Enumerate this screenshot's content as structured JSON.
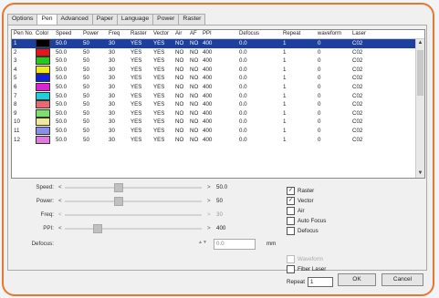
{
  "tabs": [
    {
      "label": "Options",
      "active": false
    },
    {
      "label": "Pen",
      "active": true
    },
    {
      "label": "Advanced",
      "active": false
    },
    {
      "label": "Paper",
      "active": false
    },
    {
      "label": "Language",
      "active": false
    },
    {
      "label": "Power",
      "active": false
    },
    {
      "label": "Raster",
      "active": false
    }
  ],
  "table": {
    "headers": [
      "Pen No.",
      "Color",
      "Speed",
      "Power",
      "Freq",
      "Raster",
      "Vector",
      "Air",
      "AF",
      "PPI",
      "Defocus",
      "Repeat",
      "waveform",
      "Laser"
    ],
    "rows": [
      {
        "pen": "1",
        "color": "#000000",
        "speed": "50.0",
        "power": "50",
        "freq": "30",
        "raster": "YES",
        "vector": "YES",
        "air": "NO",
        "af": "NO",
        "ppi": "400",
        "defocus": "0.0",
        "repeat": "1",
        "waveform": "0",
        "laser": "C02",
        "selected": true
      },
      {
        "pen": "2",
        "color": "#e8141c",
        "speed": "50.0",
        "power": "50",
        "freq": "30",
        "raster": "YES",
        "vector": "YES",
        "air": "NO",
        "af": "NO",
        "ppi": "400",
        "defocus": "0.0",
        "repeat": "1",
        "waveform": "0",
        "laser": "C02",
        "selected": false
      },
      {
        "pen": "3",
        "color": "#26c81e",
        "speed": "50.0",
        "power": "50",
        "freq": "30",
        "raster": "YES",
        "vector": "YES",
        "air": "NO",
        "af": "NO",
        "ppi": "400",
        "defocus": "0.0",
        "repeat": "1",
        "waveform": "0",
        "laser": "C02",
        "selected": false
      },
      {
        "pen": "4",
        "color": "#f0e81a",
        "speed": "50.0",
        "power": "50",
        "freq": "30",
        "raster": "YES",
        "vector": "YES",
        "air": "NO",
        "af": "NO",
        "ppi": "400",
        "defocus": "0.0",
        "repeat": "1",
        "waveform": "0",
        "laser": "C02",
        "selected": false
      },
      {
        "pen": "5",
        "color": "#1222d8",
        "speed": "50.0",
        "power": "50",
        "freq": "30",
        "raster": "YES",
        "vector": "YES",
        "air": "NO",
        "af": "NO",
        "ppi": "400",
        "defocus": "0.0",
        "repeat": "1",
        "waveform": "0",
        "laser": "C02",
        "selected": false
      },
      {
        "pen": "6",
        "color": "#e020d8",
        "speed": "50.0",
        "power": "50",
        "freq": "30",
        "raster": "YES",
        "vector": "YES",
        "air": "NO",
        "af": "NO",
        "ppi": "400",
        "defocus": "0.0",
        "repeat": "1",
        "waveform": "0",
        "laser": "C02",
        "selected": false
      },
      {
        "pen": "7",
        "color": "#20d0d8",
        "speed": "50.0",
        "power": "50",
        "freq": "30",
        "raster": "YES",
        "vector": "YES",
        "air": "NO",
        "af": "NO",
        "ppi": "400",
        "defocus": "0.0",
        "repeat": "1",
        "waveform": "0",
        "laser": "C02",
        "selected": false
      },
      {
        "pen": "8",
        "color": "#e86a70",
        "speed": "50.0",
        "power": "50",
        "freq": "30",
        "raster": "YES",
        "vector": "YES",
        "air": "NO",
        "af": "NO",
        "ppi": "400",
        "defocus": "0.0",
        "repeat": "1",
        "waveform": "0",
        "laser": "C02",
        "selected": false
      },
      {
        "pen": "9",
        "color": "#7ae070",
        "speed": "50.0",
        "power": "50",
        "freq": "30",
        "raster": "YES",
        "vector": "YES",
        "air": "NO",
        "af": "NO",
        "ppi": "400",
        "defocus": "0.0",
        "repeat": "1",
        "waveform": "0",
        "laser": "C02",
        "selected": false
      },
      {
        "pen": "10",
        "color": "#f0e898",
        "speed": "50.0",
        "power": "50",
        "freq": "30",
        "raster": "YES",
        "vector": "YES",
        "air": "NO",
        "af": "NO",
        "ppi": "400",
        "defocus": "0.0",
        "repeat": "1",
        "waveform": "0",
        "laser": "C02",
        "selected": false
      },
      {
        "pen": "11",
        "color": "#8a8ee8",
        "speed": "50.0",
        "power": "50",
        "freq": "30",
        "raster": "YES",
        "vector": "YES",
        "air": "NO",
        "af": "NO",
        "ppi": "400",
        "defocus": "0.0",
        "repeat": "1",
        "waveform": "0",
        "laser": "C02",
        "selected": false
      },
      {
        "pen": "12",
        "color": "#e07ae0",
        "speed": "50.0",
        "power": "50",
        "freq": "30",
        "raster": "YES",
        "vector": "YES",
        "air": "NO",
        "af": "NO",
        "ppi": "400",
        "defocus": "0.0",
        "repeat": "1",
        "waveform": "0",
        "laser": "C02",
        "selected": false
      }
    ]
  },
  "params": [
    {
      "label": "Speed:",
      "value": "50.0",
      "level": 0.38,
      "disabled": false
    },
    {
      "label": "Power:",
      "value": "50",
      "level": 0.38,
      "disabled": false
    },
    {
      "label": "Freq:",
      "value": "30",
      "level": 0.0,
      "disabled": true
    },
    {
      "label": "PPI:",
      "value": "400",
      "level": 0.22,
      "disabled": false
    }
  ],
  "defocus": {
    "label": "Defocus:",
    "value": "0.0",
    "unit": "mm"
  },
  "checks": [
    {
      "label": "Raster",
      "checked": true,
      "disabled": false
    },
    {
      "label": "Vector",
      "checked": true,
      "disabled": false
    },
    {
      "label": "Air",
      "checked": false,
      "disabled": false
    },
    {
      "label": "Auto Focus",
      "checked": false,
      "disabled": false
    },
    {
      "label": "Defocus",
      "checked": false,
      "disabled": false
    }
  ],
  "checks2": [
    {
      "label": "Waveform",
      "checked": false,
      "disabled": true
    },
    {
      "label": "Fiber Laser",
      "checked": false,
      "disabled": false
    }
  ],
  "repeat": {
    "label": "Repeat",
    "value": "1"
  },
  "buttons": {
    "ok": "OK",
    "cancel": "Cancel"
  }
}
